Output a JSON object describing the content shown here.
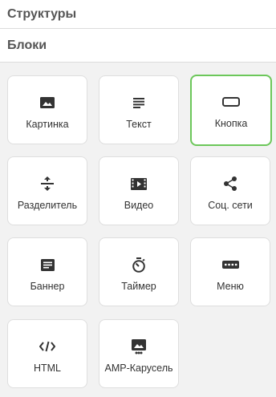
{
  "sections": {
    "structures_title": "Структуры",
    "blocks_title": "Блоки"
  },
  "blocks": [
    {
      "label": "Картинка",
      "icon": "image-icon"
    },
    {
      "label": "Текст",
      "icon": "text-icon"
    },
    {
      "label": "Кнопка",
      "icon": "button-icon",
      "selected": true
    },
    {
      "label": "Разделитель",
      "icon": "divider-icon"
    },
    {
      "label": "Видео",
      "icon": "video-icon"
    },
    {
      "label": "Соц. сети",
      "icon": "share-icon"
    },
    {
      "label": "Баннер",
      "icon": "banner-icon"
    },
    {
      "label": "Таймер",
      "icon": "timer-icon"
    },
    {
      "label": "Меню",
      "icon": "menu-icon"
    },
    {
      "label": "HTML",
      "icon": "code-icon"
    },
    {
      "label": "AMP-Карусель",
      "icon": "carousel-icon"
    }
  ],
  "colors": {
    "selected_border": "#6cc75a",
    "icon": "#333333"
  }
}
